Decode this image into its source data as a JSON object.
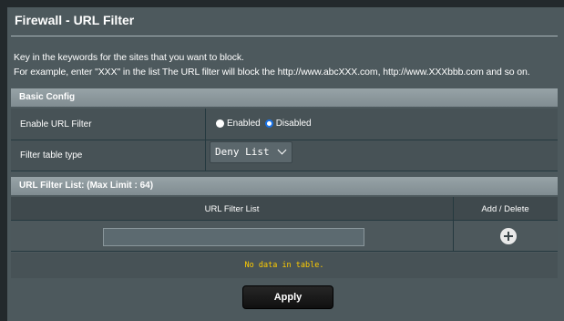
{
  "page": {
    "title": "Firewall - URL Filter",
    "description_line1": "Key in the keywords for the sites that you want to block.",
    "description_line2": "For example, enter \"XXX\" in the list The URL filter will block the http://www.abcXXX.com, http://www.XXXbbb.com and so on."
  },
  "basic_config": {
    "header": "Basic Config",
    "enable_label": "Enable URL Filter",
    "radio_enabled_label": "Enabled",
    "radio_disabled_label": "Disabled",
    "selected": "Disabled",
    "filter_type_label": "Filter table type",
    "filter_type_value": "Deny List"
  },
  "url_filter_list": {
    "header": "URL Filter List: (Max Limit : 64)",
    "col_list": "URL Filter List",
    "col_add_delete": "Add / Delete",
    "input_value": "",
    "empty_message": "No data in table."
  },
  "actions": {
    "apply_label": "Apply"
  },
  "colors": {
    "background": "#4d595d",
    "section_header": "#8a969b",
    "empty_message": "#ffcc00",
    "radio_selected": "#1a73e8"
  },
  "icons": {
    "add": "plus-circle-icon",
    "select_arrow": "chevron-down-icon"
  }
}
